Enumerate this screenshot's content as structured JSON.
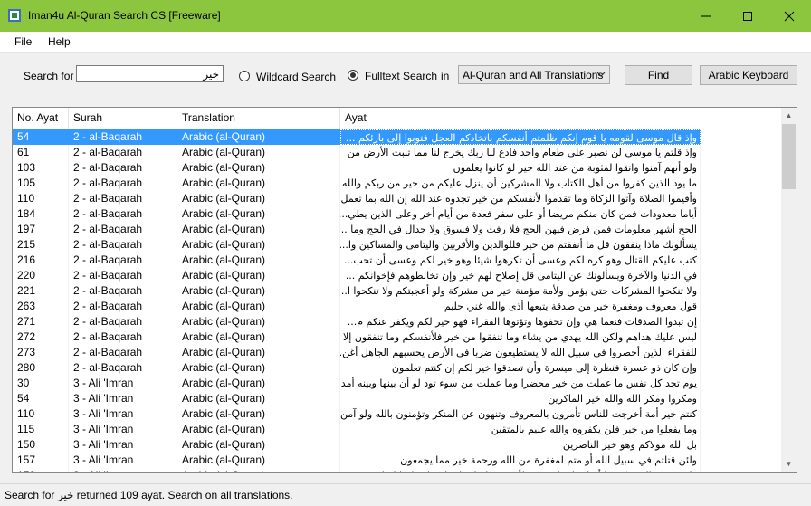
{
  "window": {
    "title": "Iman4u Al-Quran Search CS [Freeware]"
  },
  "menu": {
    "file": "File",
    "help": "Help"
  },
  "search": {
    "label": "Search for",
    "value": "خير",
    "wildcard_label": "Wildcard Search",
    "fulltext_label": "Fulltext Search",
    "in_label": "in",
    "scope_selected": "Al-Quran and All Translations",
    "find_label": "Find",
    "keyboard_label": "Arabic Keyboard"
  },
  "table": {
    "columns": [
      "No. Ayat",
      "Surah",
      "Translation",
      "Ayat"
    ],
    "rows": [
      [
        "54",
        "2 - al-Baqarah",
        "Arabic (al-Quran)",
        "وإذ قال موسى لقومه يا قوم إنكم ظلمتم أنفسكم باتخاذكم العجل فتوبوا إلى بارئكم ..."
      ],
      [
        "61",
        "2 - al-Baqarah",
        "Arabic (al-Quran)",
        "وإذ قلتم يا موسى لن نصبر على طعام واحد فادع لنا ربك يخرج لنا مما تنبت الأرض من"
      ],
      [
        "103",
        "2 - al-Baqarah",
        "Arabic (al-Quran)",
        "ولو أنهم آمنوا واتقوا لمثوبة من عند الله خير لو كانوا يعلمون"
      ],
      [
        "105",
        "2 - al-Baqarah",
        "Arabic (al-Quran)",
        "ما يود الذين كفروا من أهل الكتاب ولا المشركين أن ينزل عليكم من خير من ربكم والله ..."
      ],
      [
        "110",
        "2 - al-Baqarah",
        "Arabic (al-Quran)",
        "وأقيموا الصلاة وآتوا الزكاة وما تقدموا لأنفسكم من خير تجدوه عند الله إن الله بما تعمل..."
      ],
      [
        "184",
        "2 - al-Baqarah",
        "Arabic (al-Quran)",
        "أياما معدودات فمن كان منكم مريضا أو على سفر فعدة من أيام أخر وعلى الذين يطي..."
      ],
      [
        "197",
        "2 - al-Baqarah",
        "Arabic (al-Quran)",
        "الحج أشهر معلومات فمن فرض فيهن الحج فلا رفث ولا فسوق ولا جدال في الحج وما ..."
      ],
      [
        "215",
        "2 - al-Baqarah",
        "Arabic (al-Quran)",
        "يسألونك ماذا ينفقون قل ما أنفقتم من خير فللوالدين والأقربين واليتامى والمساكين وا..."
      ],
      [
        "216",
        "2 - al-Baqarah",
        "Arabic (al-Quran)",
        "كتب عليكم القتال وهو كره لكم وعسى أن تكرهوا شيئا وهو خير لكم وعسى أن تحب..."
      ],
      [
        "220",
        "2 - al-Baqarah",
        "Arabic (al-Quran)",
        "في الدنيا والآخرة ويسألونك عن اليتامى قل إصلاح لهم خير وإن تخالطوهم فإخوانكم ..."
      ],
      [
        "221",
        "2 - al-Baqarah",
        "Arabic (al-Quran)",
        "ولا تنكحوا المشركات حتى يؤمن ولأمة مؤمنة خير من مشركة ولو أعجبتكم ولا تنكحوا ا..."
      ],
      [
        "263",
        "2 - al-Baqarah",
        "Arabic (al-Quran)",
        "قول معروف ومغفرة خير من صدقة يتبعها أذى والله غني حليم"
      ],
      [
        "271",
        "2 - al-Baqarah",
        "Arabic (al-Quran)",
        "إن تبدوا الصدقات فنعما هي وإن تخفوها وتؤتوها الفقراء فهو خير لكم ويكفر عنكم م..."
      ],
      [
        "272",
        "2 - al-Baqarah",
        "Arabic (al-Quran)",
        "ليس عليك هداهم ولكن الله يهدي من يشاء وما تنفقوا من خير فلأنفسكم وما تنفقون إلا ا..."
      ],
      [
        "273",
        "2 - al-Baqarah",
        "Arabic (al-Quran)",
        "للفقراء الذين أحصروا في سبيل الله لا يستطيعون ضربا في الأرض يحسبهم الجاهل أغن..."
      ],
      [
        "280",
        "2 - al-Baqarah",
        "Arabic (al-Quran)",
        "وإن كان ذو عسرة فنظرة إلى ميسرة وأن تصدقوا خير لكم إن كنتم تعلمون"
      ],
      [
        "30",
        "3 - Ali 'Imran",
        "Arabic (al-Quran)",
        "يوم تجد كل نفس ما عملت من خير محضرا وما عملت من سوء تود لو أن بينها وبينه أمدا ..."
      ],
      [
        "54",
        "3 - Ali 'Imran",
        "Arabic (al-Quran)",
        "ومكروا ومكر الله والله خير الماكرين"
      ],
      [
        "110",
        "3 - Ali 'Imran",
        "Arabic (al-Quran)",
        "كنتم خير أمة أخرجت للناس تأمرون بالمعروف وتنهون عن المنكر وتؤمنون بالله ولو آمن..."
      ],
      [
        "115",
        "3 - Ali 'Imran",
        "Arabic (al-Quran)",
        "وما يفعلوا من خير فلن يكفروه والله عليم بالمتقين"
      ],
      [
        "150",
        "3 - Ali 'Imran",
        "Arabic (al-Quran)",
        "بل الله مولاكم وهو خير الناصرين"
      ],
      [
        "157",
        "3 - Ali 'Imran",
        "Arabic (al-Quran)",
        "ولئن قتلتم في سبيل الله أو متم لمغفرة من الله ورحمة خير مما يجمعون"
      ],
      [
        "178",
        "3 - Ali 'Imran",
        "Arabic (al-Quran)",
        "ولا يحسبن الذين كفروا أنما نملي لهم خير لأنفسهم إنما نملي لهم ليزدادوا إثما ..."
      ]
    ]
  },
  "status": {
    "text": "Search for خير returned 109 ayat. Search on all translations."
  },
  "colors": {
    "titlebar": "#8cc63f",
    "selection": "#3399ff"
  }
}
